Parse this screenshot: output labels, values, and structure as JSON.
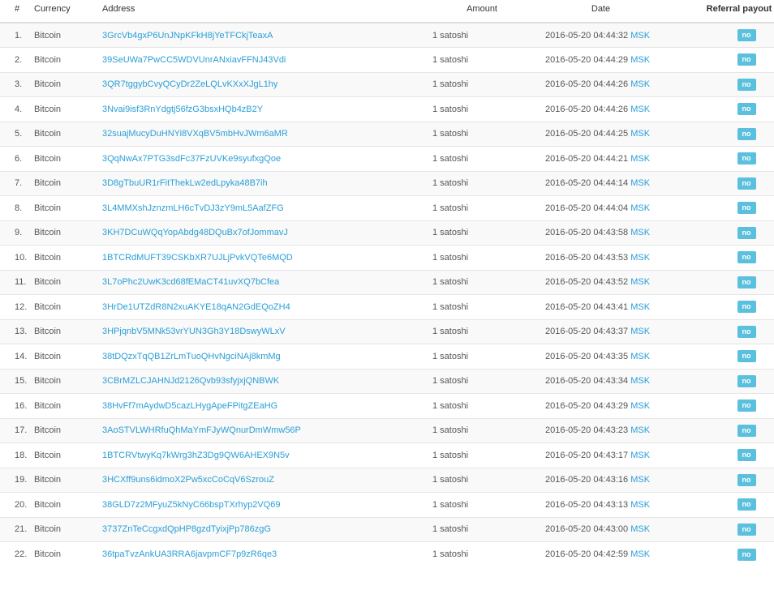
{
  "table": {
    "headers": {
      "num": "#",
      "currency": "Currency",
      "address": "Address",
      "amount": "Amount",
      "date": "Date",
      "referral": "Referral payout"
    },
    "rows": [
      {
        "num": "1.",
        "currency": "Bitcoin",
        "address": "3GrcVb4gxP6UnJNpKFkH8jYeTFCkjTeaxA",
        "amount": "1 satoshi",
        "date": "2016-05-20 04:44:32",
        "tz": "MSK",
        "referral": "no"
      },
      {
        "num": "2.",
        "currency": "Bitcoin",
        "address": "39SeUWa7PwCC5WDVUnrANxiavFFNJ43Vdi",
        "amount": "1 satoshi",
        "date": "2016-05-20 04:44:29",
        "tz": "MSK",
        "referral": "no"
      },
      {
        "num": "3.",
        "currency": "Bitcoin",
        "address": "3QR7tggybCvyQCyDr2ZeLQLvKXxXJgL1hy",
        "amount": "1 satoshi",
        "date": "2016-05-20 04:44:26",
        "tz": "MSK",
        "referral": "no"
      },
      {
        "num": "4.",
        "currency": "Bitcoin",
        "address": "3Nvai9isf3RnYdgtj56fzG3bsxHQb4zB2Y",
        "amount": "1 satoshi",
        "date": "2016-05-20 04:44:26",
        "tz": "MSK",
        "referral": "no"
      },
      {
        "num": "5.",
        "currency": "Bitcoin",
        "address": "32suajMucyDuHNYi8VXqBV5mbHvJWm6aMR",
        "amount": "1 satoshi",
        "date": "2016-05-20 04:44:25",
        "tz": "MSK",
        "referral": "no"
      },
      {
        "num": "6.",
        "currency": "Bitcoin",
        "address": "3QqNwAx7PTG3sdFc37FzUVKe9syufxgQoe",
        "amount": "1 satoshi",
        "date": "2016-05-20 04:44:21",
        "tz": "MSK",
        "referral": "no"
      },
      {
        "num": "7.",
        "currency": "Bitcoin",
        "address": "3D8gTbuUR1rFitThekLw2edLpyka48B7ih",
        "amount": "1 satoshi",
        "date": "2016-05-20 04:44:14",
        "tz": "MSK",
        "referral": "no"
      },
      {
        "num": "8.",
        "currency": "Bitcoin",
        "address": "3L4MMXshJznzmLH6cTvDJ3zY9mL5AafZFG",
        "amount": "1 satoshi",
        "date": "2016-05-20 04:44:04",
        "tz": "MSK",
        "referral": "no"
      },
      {
        "num": "9.",
        "currency": "Bitcoin",
        "address": "3KH7DCuWQqYopAbdg48DQuBx7ofJommavJ",
        "amount": "1 satoshi",
        "date": "2016-05-20 04:43:58",
        "tz": "MSK",
        "referral": "no"
      },
      {
        "num": "10.",
        "currency": "Bitcoin",
        "address": "1BTCRdMUFT39CSKbXR7UJLjPvkVQTe6MQD",
        "amount": "1 satoshi",
        "date": "2016-05-20 04:43:53",
        "tz": "MSK",
        "referral": "no"
      },
      {
        "num": "11.",
        "currency": "Bitcoin",
        "address": "3L7oPhc2UwK3cd68fEMaCT41uvXQ7bCfea",
        "amount": "1 satoshi",
        "date": "2016-05-20 04:43:52",
        "tz": "MSK",
        "referral": "no"
      },
      {
        "num": "12.",
        "currency": "Bitcoin",
        "address": "3HrDe1UTZdR8N2xuAKYE18qAN2GdEQoZH4",
        "amount": "1 satoshi",
        "date": "2016-05-20 04:43:41",
        "tz": "MSK",
        "referral": "no"
      },
      {
        "num": "13.",
        "currency": "Bitcoin",
        "address": "3HPjqnbV5MNk53vrYUN3Gh3Y18DswyWLxV",
        "amount": "1 satoshi",
        "date": "2016-05-20 04:43:37",
        "tz": "MSK",
        "referral": "no"
      },
      {
        "num": "14.",
        "currency": "Bitcoin",
        "address": "38tDQzxTqQB1ZrLmTuoQHvNgciNAj8kmMg",
        "amount": "1 satoshi",
        "date": "2016-05-20 04:43:35",
        "tz": "MSK",
        "referral": "no"
      },
      {
        "num": "15.",
        "currency": "Bitcoin",
        "address": "3CBrMZLCJAHNJd2126Qvb93sfyjxjQNBWK",
        "amount": "1 satoshi",
        "date": "2016-05-20 04:43:34",
        "tz": "MSK",
        "referral": "no"
      },
      {
        "num": "16.",
        "currency": "Bitcoin",
        "address": "38HvFf7mAydwD5cazLHygApeFPitgZEaHG",
        "amount": "1 satoshi",
        "date": "2016-05-20 04:43:29",
        "tz": "MSK",
        "referral": "no"
      },
      {
        "num": "17.",
        "currency": "Bitcoin",
        "address": "3AoSTVLWHRfuQhMaYmFJyWQnurDmWmw56P",
        "amount": "1 satoshi",
        "date": "2016-05-20 04:43:23",
        "tz": "MSK",
        "referral": "no"
      },
      {
        "num": "18.",
        "currency": "Bitcoin",
        "address": "1BTCRVtwyKq7kWrg3hZ3Dg9QW6AHEX9N5v",
        "amount": "1 satoshi",
        "date": "2016-05-20 04:43:17",
        "tz": "MSK",
        "referral": "no"
      },
      {
        "num": "19.",
        "currency": "Bitcoin",
        "address": "3HCXff9uns6idmoX2Pw5xcCoCqV6SzrouZ",
        "amount": "1 satoshi",
        "date": "2016-05-20 04:43:16",
        "tz": "MSK",
        "referral": "no"
      },
      {
        "num": "20.",
        "currency": "Bitcoin",
        "address": "38GLD7z2MFyuZ5kNyC66bspTXrhyp2VQ69",
        "amount": "1 satoshi",
        "date": "2016-05-20 04:43:13",
        "tz": "MSK",
        "referral": "no"
      },
      {
        "num": "21.",
        "currency": "Bitcoin",
        "address": "3737ZnTeCcgxdQpHP8gzdTyixjPp786zgG",
        "amount": "1 satoshi",
        "date": "2016-05-20 04:43:00",
        "tz": "MSK",
        "referral": "no"
      },
      {
        "num": "22.",
        "currency": "Bitcoin",
        "address": "36tpaTvzAnkUA3RRA6javpmCF7p9zR6qe3",
        "amount": "1 satoshi",
        "date": "2016-05-20 04:42:59",
        "tz": "MSK",
        "referral": "no"
      }
    ]
  },
  "colors": {
    "link": "#2a9fd6",
    "badge": "#5bc0de",
    "stripe": "#f9f9f9"
  }
}
